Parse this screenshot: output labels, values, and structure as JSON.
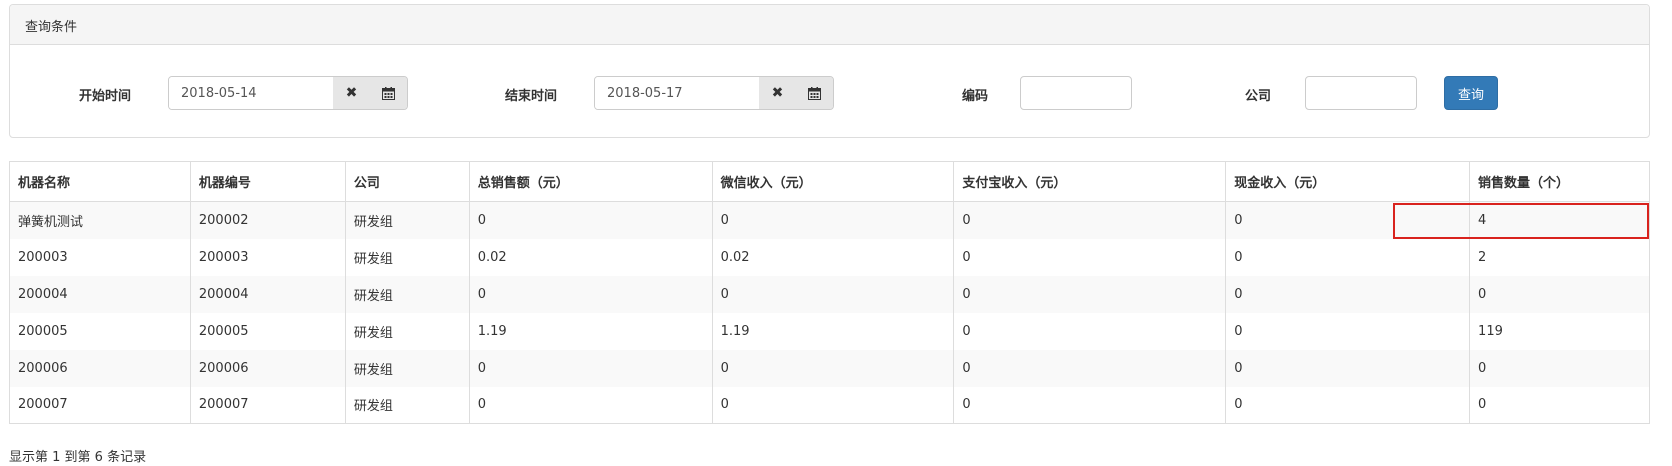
{
  "query_panel": {
    "title": "查询条件",
    "start_label": "开始时间",
    "start_value": "2018-05-14",
    "end_label": "结束时间",
    "end_value": "2018-05-17",
    "code_label": "编码",
    "code_value": "",
    "company_label": "公司",
    "company_value": "",
    "search_button": "查询",
    "clear_icon": "times-icon",
    "calendar_icon": "calendar-icon"
  },
  "table": {
    "headers": [
      "机器名称",
      "机器编号",
      "公司",
      "总销售额（元）",
      "微信收入（元）",
      "支付宝收入（元）",
      "现金收入（元）",
      "销售数量（个）"
    ],
    "rows": [
      [
        "弹簧机测试",
        "200002",
        "研发组",
        "0",
        "0",
        "0",
        "0",
        "4"
      ],
      [
        "200003",
        "200003",
        "研发组",
        "0.02",
        "0.02",
        "0",
        "0",
        "2"
      ],
      [
        "200004",
        "200004",
        "研发组",
        "0",
        "0",
        "0",
        "0",
        "0"
      ],
      [
        "200005",
        "200005",
        "研发组",
        "1.19",
        "1.19",
        "0",
        "0",
        "119"
      ],
      [
        "200006",
        "200006",
        "研发组",
        "0",
        "0",
        "0",
        "0",
        "0"
      ],
      [
        "200007",
        "200007",
        "研发组",
        "0",
        "0",
        "0",
        "0",
        "0"
      ]
    ]
  },
  "pagination_info": "显示第 1 到第 6 条记录",
  "colors": {
    "primary": "#337ab7",
    "highlight": "#d9231e"
  }
}
